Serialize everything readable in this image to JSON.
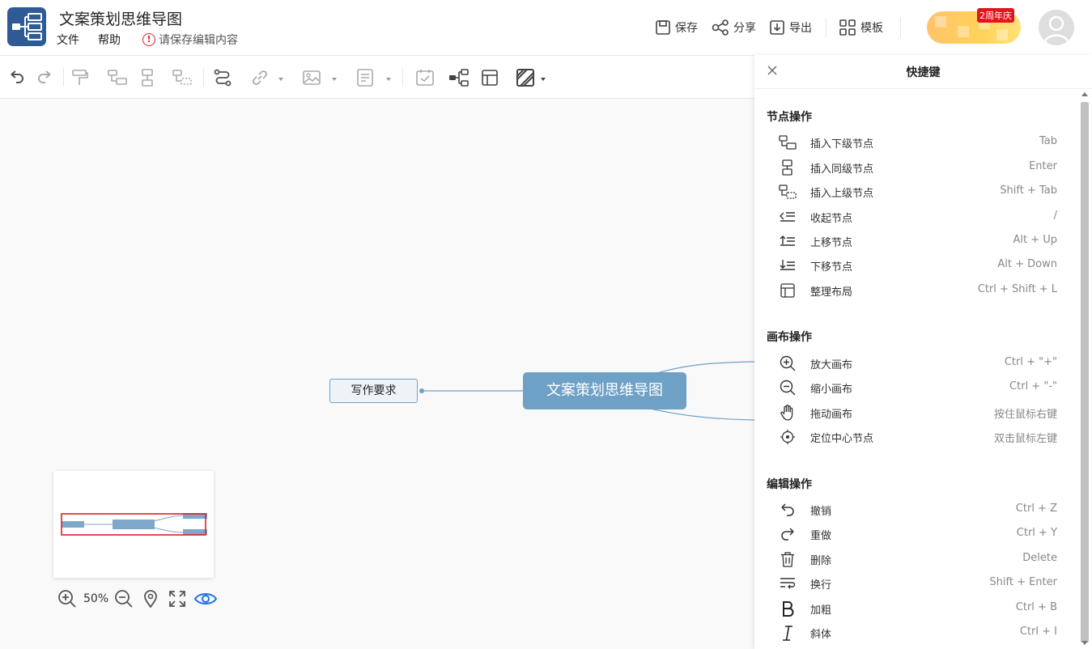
{
  "header": {
    "title": "文案策划思维导图",
    "menu_file": "文件",
    "menu_help": "帮助",
    "warning": "请保存编辑内容",
    "save": "保存",
    "share": "分享",
    "export": "导出",
    "template": "模板",
    "promo_badge": "2周年庆"
  },
  "canvas": {
    "root_node": "文案策划思维导图",
    "child_node": "写作要求",
    "zoom_level": "50%"
  },
  "panel": {
    "title": "快捷键",
    "sections": [
      {
        "title": "节点操作",
        "items": [
          {
            "label": "插入下级节点",
            "key": "Tab",
            "icon": "insert-child-icon"
          },
          {
            "label": "插入同级节点",
            "key": "Enter",
            "icon": "insert-sibling-icon"
          },
          {
            "label": "插入上级节点",
            "key": "Shift + Tab",
            "icon": "insert-parent-icon"
          },
          {
            "label": "收起节点",
            "key": "/",
            "icon": "collapse-icon"
          },
          {
            "label": "上移节点",
            "key": "Alt + Up",
            "icon": "move-up-icon"
          },
          {
            "label": "下移节点",
            "key": "Alt + Down",
            "icon": "move-down-icon"
          },
          {
            "label": "整理布局",
            "key": "Ctrl + Shift + L",
            "icon": "layout-icon"
          }
        ]
      },
      {
        "title": "画布操作",
        "items": [
          {
            "label": "放大画布",
            "key": "Ctrl + \"+\"",
            "icon": "zoom-in-icon"
          },
          {
            "label": "缩小画布",
            "key": "Ctrl + \"-\"",
            "icon": "zoom-out-icon"
          },
          {
            "label": "拖动画布",
            "key": "按住鼠标右键",
            "icon": "hand-icon"
          },
          {
            "label": "定位中心节点",
            "key": "双击鼠标左键",
            "icon": "locate-icon"
          }
        ]
      },
      {
        "title": "编辑操作",
        "items": [
          {
            "label": "撤销",
            "key": "Ctrl + Z",
            "icon": "undo-icon"
          },
          {
            "label": "重做",
            "key": "Ctrl + Y",
            "icon": "redo-icon"
          },
          {
            "label": "删除",
            "key": "Delete",
            "icon": "trash-icon"
          },
          {
            "label": "换行",
            "key": "Shift + Enter",
            "icon": "wrap-icon"
          },
          {
            "label": "加粗",
            "key": "Ctrl + B",
            "icon": "bold-icon"
          },
          {
            "label": "斜体",
            "key": "Ctrl + I",
            "icon": "italic-icon"
          }
        ]
      }
    ]
  },
  "colors": {
    "brand": "#2e5a96",
    "node": "#6fa1c6",
    "accent_blue": "#1a73e8",
    "warning_red": "#e02020"
  }
}
